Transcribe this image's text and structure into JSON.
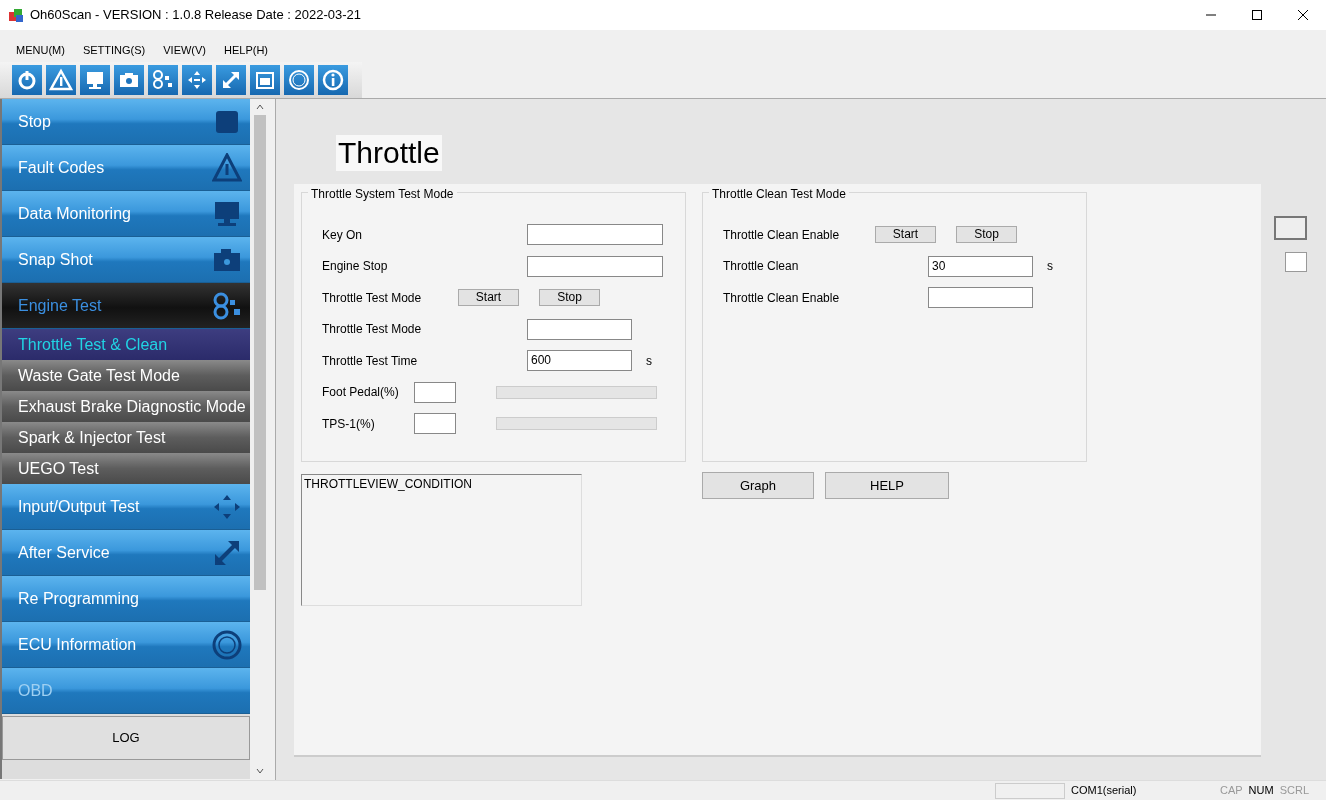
{
  "window": {
    "title": "Oh60Scan - VERSION : 1.0.8 Release Date : 2022-03-21"
  },
  "menu": [
    "MENU(M)",
    "SETTING(S)",
    "VIEW(V)",
    "HELP(H)"
  ],
  "sidebar": {
    "items": [
      {
        "label": "Stop",
        "kind": "main",
        "selected": false,
        "disabled": false
      },
      {
        "label": "Fault Codes",
        "kind": "main",
        "selected": false,
        "disabled": false
      },
      {
        "label": "Data Monitoring",
        "kind": "main",
        "selected": false,
        "disabled": false
      },
      {
        "label": "Snap Shot",
        "kind": "main",
        "selected": false,
        "disabled": false
      },
      {
        "label": "Engine Test",
        "kind": "main",
        "selected": true,
        "disabled": false,
        "children": [
          {
            "label": "Throttle Test & Clean",
            "selected": true
          },
          {
            "label": "Waste Gate Test Mode",
            "selected": false
          },
          {
            "label": "Exhaust Brake Diagnostic Mode",
            "selected": false
          },
          {
            "label": "Spark & Injector Test",
            "selected": false
          },
          {
            "label": "UEGO Test",
            "selected": false
          }
        ]
      },
      {
        "label": "Input/Output Test",
        "kind": "main",
        "selected": false,
        "disabled": false
      },
      {
        "label": "After Service",
        "kind": "main",
        "selected": false,
        "disabled": false
      },
      {
        "label": "Re Programming",
        "kind": "main",
        "selected": false,
        "disabled": false
      },
      {
        "label": "ECU Information",
        "kind": "main",
        "selected": false,
        "disabled": false
      },
      {
        "label": "OBD",
        "kind": "main",
        "selected": false,
        "disabled": true
      }
    ],
    "log_button": "LOG"
  },
  "page_title": "Throttle",
  "groups": [
    {
      "title": "Throttle System Test Mode",
      "rows": [
        {
          "kind": "field",
          "label": "Key On",
          "value": ""
        },
        {
          "kind": "field",
          "label": "Engine Stop",
          "value": ""
        },
        {
          "kind": "buttons",
          "label": "Throttle Test Mode",
          "buttons": [
            "Start",
            "Stop"
          ]
        },
        {
          "kind": "field",
          "label": "Throttle Test Mode",
          "value": ""
        },
        {
          "kind": "field",
          "label": "Throttle Test Time",
          "value": "600",
          "unit": "s"
        },
        {
          "kind": "gauge",
          "label": "Foot Pedal(%)",
          "value": "",
          "level": 0
        },
        {
          "kind": "gauge",
          "label": "TPS-1(%)",
          "value": "",
          "level": 0
        }
      ]
    },
    {
      "title": "Throttle Clean Test Mode",
      "rows": [
        {
          "kind": "buttons",
          "label": "Throttle Clean Enable",
          "buttons": [
            "Start",
            "Stop"
          ]
        },
        {
          "kind": "field",
          "label": "Throttle Clean",
          "value": "30",
          "unit": "s"
        },
        {
          "kind": "field",
          "label": "Throttle Clean Enable",
          "value": ""
        }
      ]
    }
  ],
  "condition_box": {
    "text": "THROTTLEVIEW_CONDITION"
  },
  "action_buttons": [
    "Graph",
    "HELP"
  ],
  "status_bar": {
    "port": "COM1(serial)",
    "indicators": [
      {
        "label": "CAP",
        "on": false
      },
      {
        "label": "NUM",
        "on": true
      },
      {
        "label": "SCRL",
        "on": false
      }
    ]
  }
}
